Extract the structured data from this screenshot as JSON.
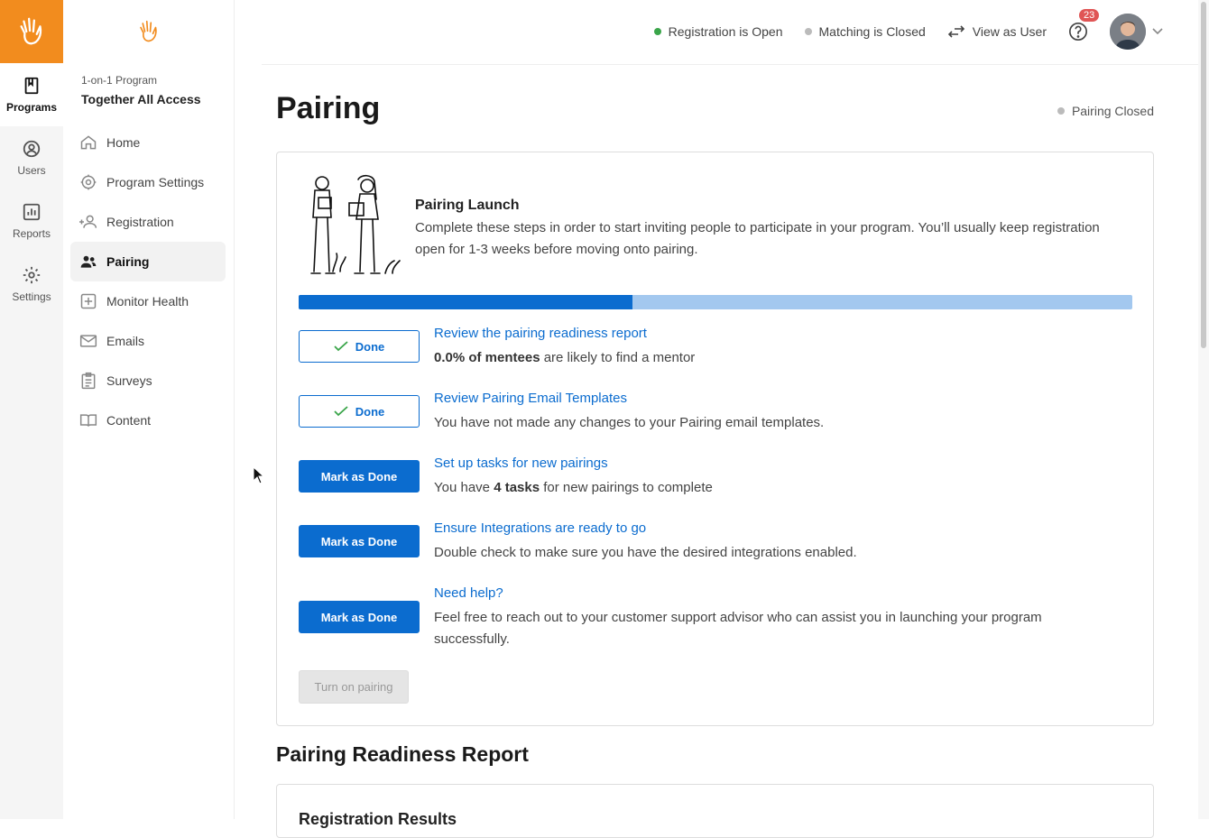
{
  "rail": {
    "items": [
      {
        "label": "Programs",
        "icon": "book-icon",
        "active": true
      },
      {
        "label": "Users",
        "icon": "user-circle-icon",
        "active": false
      },
      {
        "label": "Reports",
        "icon": "bar-chart-icon",
        "active": false
      },
      {
        "label": "Settings",
        "icon": "gear-icon",
        "active": false
      }
    ]
  },
  "program": {
    "subtitle": "1-on-1 Program",
    "name": "Together All Access"
  },
  "sidebar": {
    "items": [
      {
        "label": "Home",
        "icon": "home-icon"
      },
      {
        "label": "Program Settings",
        "icon": "gear-icon"
      },
      {
        "label": "Registration",
        "icon": "user-add-icon"
      },
      {
        "label": "Pairing",
        "icon": "users-icon",
        "active": true
      },
      {
        "label": "Monitor Health",
        "icon": "plus-square-icon"
      },
      {
        "label": "Emails",
        "icon": "envelope-icon"
      },
      {
        "label": "Surveys",
        "icon": "clipboard-icon"
      },
      {
        "label": "Content",
        "icon": "open-book-icon"
      }
    ]
  },
  "topbar": {
    "registration": "Registration is Open",
    "matching": "Matching is Closed",
    "view_as_user": "View as User",
    "notification_count": "23"
  },
  "colors": {
    "brand": "#f28c1e",
    "accent": "#0b6ccf",
    "open": "#3aa54a",
    "closed": "#bbbbbb",
    "badge": "#e05555"
  },
  "page": {
    "title": "Pairing",
    "status": "Pairing Closed"
  },
  "launch": {
    "title": "Pairing Launch",
    "description": "Complete these steps in order to start inviting people to participate in your program. You’ll usually keep registration open for 1-3 weeks before moving onto pairing.",
    "progress": 0.4
  },
  "steps": [
    {
      "button": "Done",
      "state": "done",
      "link": "Review the pairing readiness report",
      "desc_bold": "0.0% of mentees",
      "desc_rest": " are likely to find a mentor"
    },
    {
      "button": "Done",
      "state": "done",
      "link": "Review Pairing Email Templates",
      "desc": "You have not made any changes to your Pairing email templates."
    },
    {
      "button": "Mark as Done",
      "state": "todo",
      "link": "Set up tasks for new pairings",
      "desc_pre": "You have ",
      "desc_bold": "4 tasks",
      "desc_rest": " for new pairings to complete"
    },
    {
      "button": "Mark as Done",
      "state": "todo",
      "link": "Ensure Integrations are ready to go",
      "desc": "Double check to make sure you have the desired integrations enabled."
    },
    {
      "button": "Mark as Done",
      "state": "todo",
      "link": "Need help?",
      "desc": "Feel free to reach out to your customer support advisor who can assist you in launching your program successfully."
    }
  ],
  "turn_on_button": "Turn on pairing",
  "readiness": {
    "section_title": "Pairing Readiness Report",
    "card_title": "Registration Results"
  }
}
